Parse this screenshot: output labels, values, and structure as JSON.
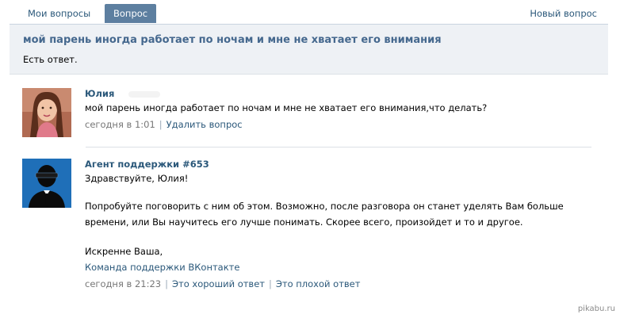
{
  "tabs": [
    {
      "label": "Мои вопросы",
      "active": false
    },
    {
      "label": "Вопрос",
      "active": true
    }
  ],
  "new_question_label": "Новый вопрос",
  "question": {
    "title": "мой парень иногда работает по ночам и мне не хватает его внимания",
    "status": "Есть ответ."
  },
  "posts": [
    {
      "author": "Юлия",
      "text": "мой парень иногда работает по ночам и мне не хватает его внимания,что делать?",
      "time": "сегодня в 1:01",
      "actions": [
        "Удалить вопрос"
      ]
    },
    {
      "author": "Агент поддержки #653",
      "greeting": "Здравствуйте, Юлия!",
      "body_line1": "Попробуйте поговорить с ним об этом. Возможно, после разговора он станет уделять Вам больше",
      "body_line2": "времени, или Вы научитесь его лучше понимать. Скорее всего, произойдет и то и другое.",
      "signoff": "Искренне Ваша,",
      "team_link": "Команда поддержки ВКонтакте",
      "time": "сегодня в 21:23",
      "actions": [
        "Это хороший ответ",
        "Это плохой ответ"
      ]
    }
  ],
  "watermark": "pikabu.ru"
}
